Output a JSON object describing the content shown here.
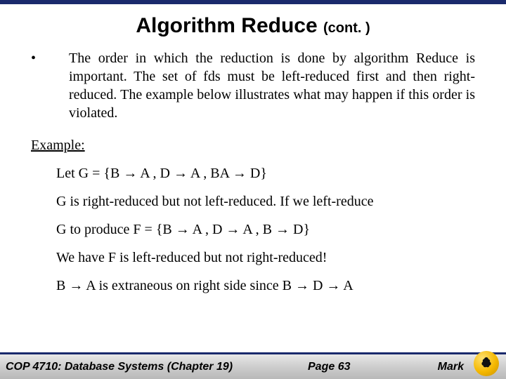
{
  "title_main": "Algorithm Reduce ",
  "title_cont": "(cont. )",
  "bullet_mark": "•",
  "bullet_text": "The order in which the reduction is done by algorithm Reduce is important.  The set of fds must be left-reduced first and then right-reduced.   The example below illustrates what may happen if this order is violated.",
  "example_label": "Example:",
  "example_lines": {
    "l1": "Let G = {B → A , D → A , BA → D}",
    "l2": "G is right-reduced but not left-reduced.  If we left-reduce",
    "l3": "G to produce F = {B → A , D → A , B → D}",
    "l4": "We have F is left-reduced but not right-reduced!",
    "l5": "B → A is extraneous on right side since B → D  → A"
  },
  "footer": {
    "course": "COP 4710: Database Systems  (Chapter 19)",
    "page": "Page 63",
    "author": "Mark"
  }
}
